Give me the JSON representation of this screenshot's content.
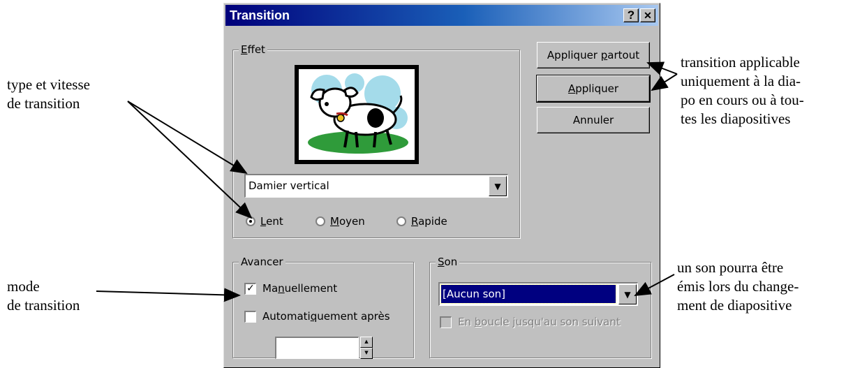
{
  "dialog": {
    "title": "Transition",
    "help_button": "?",
    "close_button": "✕"
  },
  "effect": {
    "group_label": "Effet",
    "selected_effect": "Damier vertical",
    "speeds": [
      {
        "label": "Lent",
        "mnemonic": "L",
        "checked": true
      },
      {
        "label": "Moyen",
        "mnemonic": "M",
        "checked": false
      },
      {
        "label": "Rapide",
        "mnemonic": "R",
        "checked": false
      }
    ]
  },
  "buttons": {
    "apply_all": "Appliquer partout",
    "apply": "Appliquer",
    "cancel": "Annuler"
  },
  "advance": {
    "group_label": "Avancer",
    "manual_label": "Manuellement",
    "manual_checked": true,
    "auto_label": "Automatiquement après",
    "auto_checked": false,
    "auto_value": ""
  },
  "sound": {
    "group_label": "Son",
    "selected_sound": "[Aucun son]",
    "loop_label": "En boucle jusqu'au son suivant",
    "loop_checked": false
  },
  "annotations": {
    "type_speed": "type et vitesse\nde transition",
    "mode": "mode\nde transition",
    "applicable": "transition applicable\nuniquement à la dia-\npo en cours ou à tou-\ntes les diapositives",
    "sound_note": "un son pourra être\némis lors du change-\nment de diapositive"
  },
  "colors": {
    "dialog_face": "#c0c0c0",
    "title_bar_start": "#00007b",
    "selection": "#000080"
  }
}
